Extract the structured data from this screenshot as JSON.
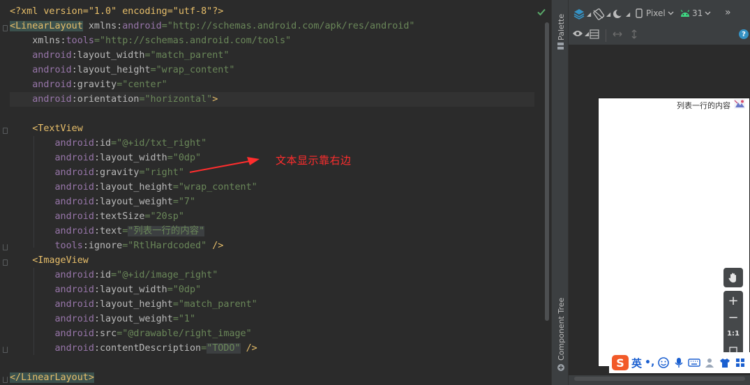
{
  "colors": {
    "tag": "#e8bf6a",
    "namespace": "#9876aa",
    "attribute": "#bababa",
    "value": "#6a8759",
    "annotation": "#ff2d2d",
    "accent_blue": "#3592c4"
  },
  "editor": {
    "lines": [
      [
        "<?xml version=\"1.0\" encoding=\"utf-8\"?>"
      ],
      [
        "<",
        "LinearLayout",
        " ",
        "xmlns:",
        "android",
        "=\"http://schemas.android.com/apk/res/android\""
      ],
      [
        "    ",
        "xmlns:",
        "tools",
        "=\"http://schemas.android.com/tools\""
      ],
      [
        "    ",
        "android",
        ":layout_width",
        "=\"match_parent\""
      ],
      [
        "    ",
        "android",
        ":layout_height",
        "=\"wrap_content\""
      ],
      [
        "    ",
        "android",
        ":gravity",
        "=\"center\""
      ],
      [
        "    ",
        "android",
        ":orientation",
        "=\"horizontal\"",
        ">"
      ],
      [
        ""
      ],
      [
        "    ",
        "<TextView"
      ],
      [
        "        ",
        "android",
        ":id",
        "=\"@+id/txt_right\""
      ],
      [
        "        ",
        "android",
        ":layout_width",
        "=\"0dp\""
      ],
      [
        "        ",
        "android",
        ":gravity",
        "=\"right\""
      ],
      [
        "        ",
        "android",
        ":layout_height",
        "=\"wrap_content\""
      ],
      [
        "        ",
        "android",
        ":layout_weight",
        "=\"7\""
      ],
      [
        "        ",
        "android",
        ":textSize",
        "=\"20sp\""
      ],
      [
        "        ",
        "android",
        ":text",
        "=",
        "\"列表一行的内容\""
      ],
      [
        "        ",
        "tools",
        ":ignore",
        "=\"RtlHardcoded\"",
        " />"
      ],
      [
        "    ",
        "<ImageView"
      ],
      [
        "        ",
        "android",
        ":id",
        "=\"@+id/image_right\""
      ],
      [
        "        ",
        "android",
        ":layout_width",
        "=\"0dp\""
      ],
      [
        "        ",
        "android",
        ":layout_height",
        "=\"match_parent\""
      ],
      [
        "        ",
        "android",
        ":layout_weight",
        "=\"1\""
      ],
      [
        "        ",
        "android",
        ":src",
        "=\"@drawable/right_image\""
      ],
      [
        "        ",
        "android",
        ":contentDescription",
        "=",
        "\"TODO\"",
        " />"
      ],
      [
        ""
      ],
      [
        "",
        "</LinearLayout>"
      ]
    ]
  },
  "annotation": {
    "text": "文本显示靠右边"
  },
  "side_strip": {
    "palette_label": "Palette",
    "component_tree_label": "Component Tree"
  },
  "design_toolbar": {
    "device_label": "Pixel",
    "api_label": "31",
    "more_label": "»",
    "help_label": "?"
  },
  "preview": {
    "text": "列表一行的内容"
  },
  "zoom": {
    "pan_icon": "hand-icon",
    "plus": "+",
    "minus": "−",
    "one_to_one": "1:1"
  },
  "ime": {
    "logo": "S",
    "language": "英",
    "punct": "•,"
  }
}
